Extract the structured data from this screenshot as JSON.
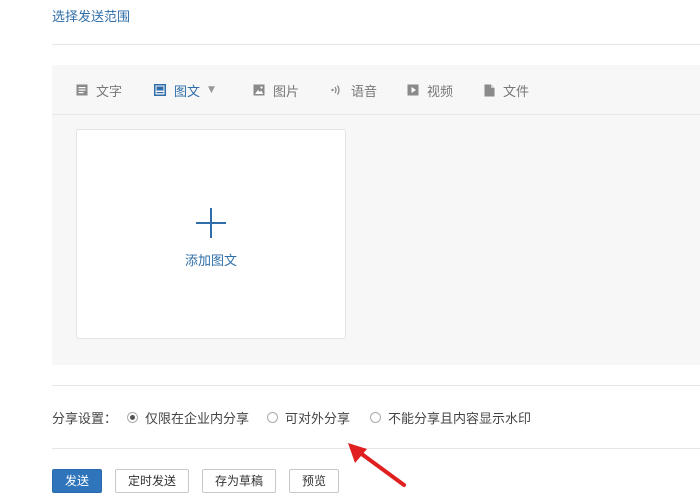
{
  "header": {
    "scope_link": "选择发送范围"
  },
  "editor": {
    "tabs": [
      {
        "label": "文字",
        "icon": "text-icon"
      },
      {
        "label": "图文",
        "icon": "image-text-icon",
        "active": true,
        "has_dropdown": true
      },
      {
        "label": "图片",
        "icon": "image-icon"
      },
      {
        "label": "语音",
        "icon": "voice-icon"
      },
      {
        "label": "视频",
        "icon": "video-icon"
      },
      {
        "label": "文件",
        "icon": "file-icon"
      }
    ],
    "add_card": {
      "label": "添加图文",
      "icon": "plus-icon"
    }
  },
  "share": {
    "label": "分享设置：",
    "options": [
      {
        "label": "仅限在企业内分享",
        "selected": true
      },
      {
        "label": "可对外分享",
        "selected": false
      },
      {
        "label": "不能分享且内容显示水印",
        "selected": false
      }
    ]
  },
  "actions": {
    "send": "发送",
    "schedule": "定时发送",
    "draft": "存为草稿",
    "preview": "预览"
  },
  "colors": {
    "accent": "#2f6ea8",
    "primary_button": "#2f75bb",
    "annotation_arrow": "#e02020"
  }
}
